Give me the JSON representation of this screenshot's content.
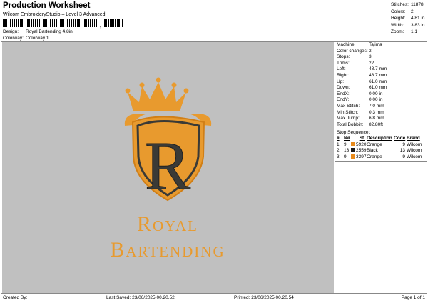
{
  "header": {
    "title": "Production Worksheet",
    "software": "Wilcom EmbroideryStudio – Level 3 Advanced",
    "design_label": "Design:",
    "design_value": "Royal Bartending 4,8in",
    "colorway_label": "Colorway:",
    "colorway_value": "Colorway 1"
  },
  "stats": [
    {
      "k": "Stitches:",
      "v": "11878"
    },
    {
      "k": "Colors:",
      "v": "2"
    },
    {
      "k": "Height:",
      "v": "4.81 in"
    },
    {
      "k": "Width:",
      "v": "3.83 in"
    },
    {
      "k": "Zoom:",
      "v": "1:1"
    }
  ],
  "machine": [
    {
      "k": "Machine:",
      "v": "Tajima"
    },
    {
      "k": "Color changes:",
      "v": "2"
    },
    {
      "k": "Stops:",
      "v": "3"
    },
    {
      "k": "Trims:",
      "v": "22"
    },
    {
      "k": "Left:",
      "v": "48.7 mm"
    },
    {
      "k": "Right:",
      "v": "48.7 mm"
    },
    {
      "k": "Up:",
      "v": "61.0 mm"
    },
    {
      "k": "Down:",
      "v": "61.0 mm"
    },
    {
      "k": "EndX:",
      "v": "0.00 in"
    },
    {
      "k": "EndY:",
      "v": "0.00 in"
    },
    {
      "k": "Max Stitch:",
      "v": "7.0 mm"
    },
    {
      "k": "Min Stitch:",
      "v": "0.3 mm"
    },
    {
      "k": "Max Jump:",
      "v": "6.8 mm"
    },
    {
      "k": "Total Bobbin:",
      "v": "82.80ft"
    }
  ],
  "stop_sequence": {
    "title": "Stop Sequence:",
    "headers": [
      "#",
      "N#",
      "St.",
      "Description",
      "Code",
      "Brand"
    ],
    "rows": [
      {
        "n": "1.",
        "needle": "9",
        "color": "#e88a1a",
        "st": "5920",
        "desc": "Orange",
        "code": "9",
        "brand": "Wilcom"
      },
      {
        "n": "2.",
        "needle": "13",
        "color": "#1a1a1a",
        "st": "2559",
        "desc": "Black",
        "code": "13",
        "brand": "Wilcom"
      },
      {
        "n": "3.",
        "needle": "9",
        "color": "#e88a1a",
        "st": "3397",
        "desc": "Orange",
        "code": "9",
        "brand": "Wilcom"
      }
    ]
  },
  "design": {
    "line1": "Royal",
    "line2": "Bartending",
    "letter": "R",
    "orange": "#e89a2e",
    "dark": "#3a3a36",
    "background": "#c0c0c0"
  },
  "footer": {
    "created": "Created By:",
    "saved": "Last Saved: 23/06/2025 00.20.52",
    "printed": "Printed: 23/06/2025 00.20.54",
    "page": "Page 1 of 1"
  }
}
